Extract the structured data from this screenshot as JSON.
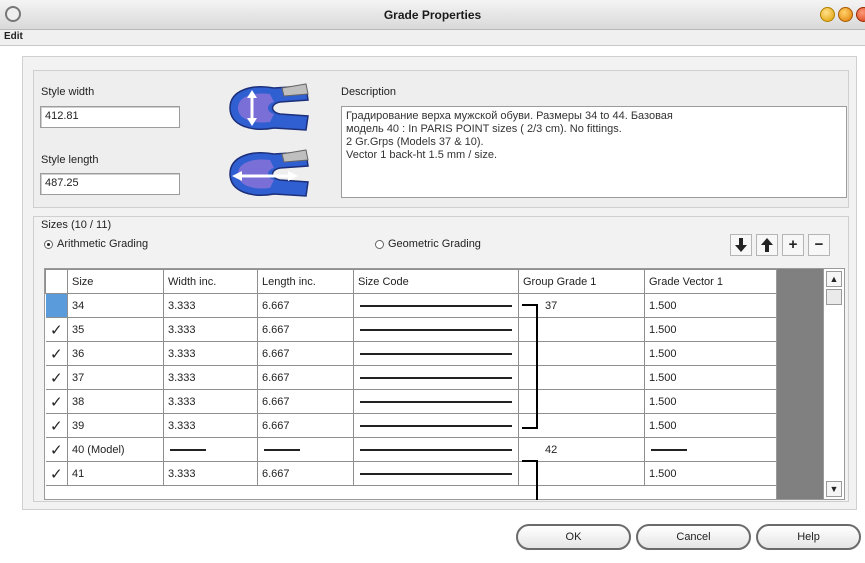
{
  "window": {
    "title": "Grade Properties"
  },
  "menu": {
    "edit_label": "Edit"
  },
  "style": {
    "width_label": "Style width",
    "width_value": "412.81",
    "length_label": "Style length",
    "length_value": "487.25"
  },
  "description": {
    "label": "Description",
    "lines": [
      "Градирование верха мужской обуви. Размеры 34 to 44. Базовая",
      "модель 40 :   In PARIS POINT sizes   ( 2/3 cm).    No fittings.",
      "2 Gr.Grps (Models 37 & 10).",
      "Vector 1 back-ht 1.5 mm / size."
    ]
  },
  "sizes": {
    "title": "Sizes (10 / 11)",
    "radio_arithmetic": "Arithmetic Grading",
    "radio_geometric": "Geometric Grading",
    "selected_mode": "arithmetic",
    "columns": [
      "Size",
      "Width inc.",
      "Length inc.",
      "Size Code",
      "Group Grade 1",
      "Grade Vector 1"
    ],
    "rows": [
      {
        "check": "",
        "size": "34",
        "width": "3.333",
        "length": "6.667",
        "code": "",
        "group": "37",
        "vector": "1.500"
      },
      {
        "check": "✓",
        "size": "35",
        "width": "3.333",
        "length": "6.667",
        "code": "",
        "group": "",
        "vector": "1.500"
      },
      {
        "check": "✓",
        "size": "36",
        "width": "3.333",
        "length": "6.667",
        "code": "",
        "group": "",
        "vector": "1.500"
      },
      {
        "check": "✓",
        "size": "37",
        "width": "3.333",
        "length": "6.667",
        "code": "",
        "group": "",
        "vector": "1.500"
      },
      {
        "check": "✓",
        "size": "38",
        "width": "3.333",
        "length": "6.667",
        "code": "",
        "group": "",
        "vector": "1.500"
      },
      {
        "check": "✓",
        "size": "39",
        "width": "3.333",
        "length": "6.667",
        "code": "",
        "group": "",
        "vector": "1.500"
      },
      {
        "check": "✓",
        "size": "40 (Model)",
        "width": "",
        "length": "",
        "code": "",
        "group": "42",
        "vector": ""
      },
      {
        "check": "✓",
        "size": "41",
        "width": "3.333",
        "length": "6.667",
        "code": "",
        "group": "",
        "vector": "1.500"
      }
    ]
  },
  "buttons": {
    "ok": "OK",
    "cancel": "Cancel",
    "help": "Help"
  },
  "icons": {
    "move_down": "arrow-down-icon",
    "move_up": "arrow-up-icon",
    "add": "plus-icon",
    "remove": "minus-icon"
  },
  "colors": {
    "selection": "#5a9bdc",
    "shoe_blue": "#2f5fd0",
    "shoe_purple": "#7a6fd6"
  }
}
